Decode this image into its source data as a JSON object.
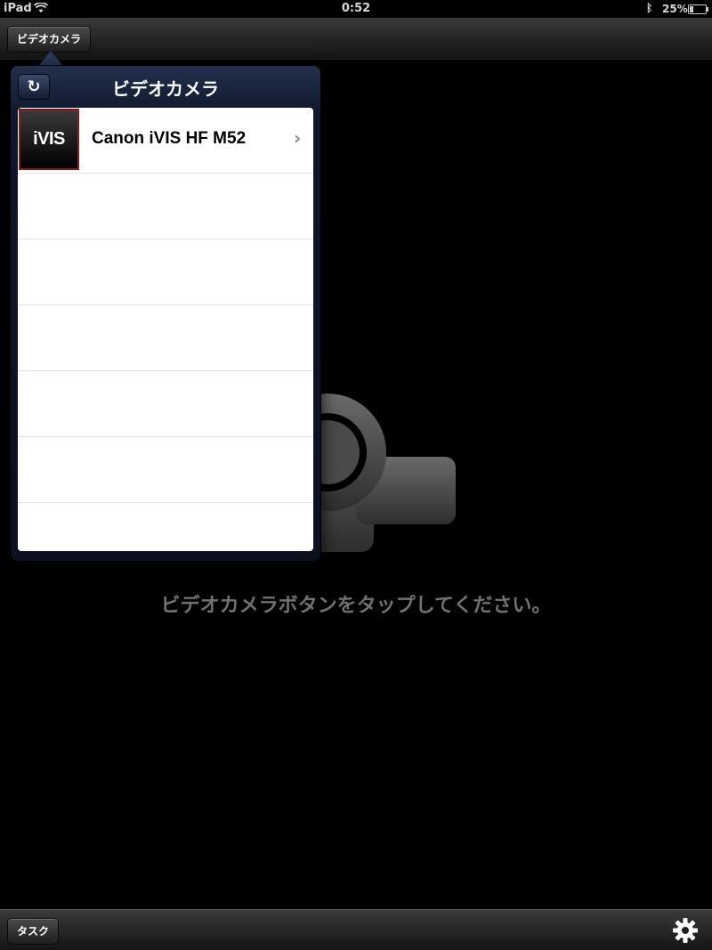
{
  "status_bar": {
    "carrier": "iPad",
    "time": "0:52",
    "battery_percent": "25%",
    "battery_level": 0.25,
    "wifi_icon": "wifi-icon",
    "bluetooth_icon": "bluetooth-icon"
  },
  "top_toolbar": {
    "video_camera_button": "ビデオカメラ"
  },
  "popover": {
    "title": "ビデオカメラ",
    "refresh_icon": "refresh-icon",
    "devices": [
      {
        "thumb_label": "iVIS",
        "name": "Canon iVIS HF M52",
        "icon": "chevron-right-icon"
      }
    ],
    "empty_rows": 5
  },
  "main": {
    "background_icon": "video-camera-icon",
    "hint": "ビデオカメラボタンをタップしてください。"
  },
  "bottom_toolbar": {
    "task_button": "タスク",
    "settings_icon": "gear-icon"
  },
  "colors": {
    "popover_header": "#1a2540",
    "thumb_border": "#8b1a1a",
    "hint_text": "#707070"
  }
}
